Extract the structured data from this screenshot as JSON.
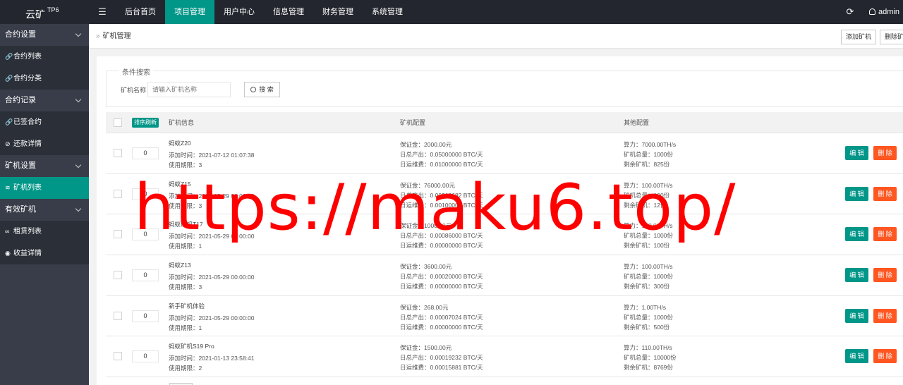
{
  "header": {
    "logo": "云矿",
    "logo_sup": "TP6",
    "menu_toggle": "☰",
    "nav": [
      "后台首页",
      "项目管理",
      "用户中心",
      "信息管理",
      "财务管理",
      "系统管理"
    ],
    "active_nav": 1,
    "refresh_icon": "⟳",
    "user": "admin"
  },
  "sidebar": {
    "groups": [
      {
        "label": "合约设置",
        "items": [
          {
            "icon": "🔗",
            "label": "合约列表"
          },
          {
            "icon": "🔗",
            "label": "合约分类"
          }
        ]
      },
      {
        "label": "合约记录",
        "items": [
          {
            "icon": "🔗",
            "label": "已签合约"
          },
          {
            "icon": "⊘",
            "label": "还款详情"
          }
        ]
      },
      {
        "label": "矿机设置",
        "items": [
          {
            "icon": "≋",
            "label": "矿机列表",
            "active": true
          }
        ]
      },
      {
        "label": "有效矿机",
        "items": [
          {
            "icon": "∞",
            "label": "租赁列表"
          },
          {
            "icon": "◉",
            "label": "收益详情"
          }
        ]
      }
    ]
  },
  "breadcrumb": {
    "sep": "»",
    "label": "矿机管理"
  },
  "toolbar": {
    "add": "添加矿机",
    "delete": "删除矿"
  },
  "search": {
    "legend": "条件搜索",
    "field_label": "矿机名称",
    "placeholder": "请输入矿机名称",
    "button": "搜 索"
  },
  "table": {
    "sort_button": "排序刷新",
    "headers": [
      "矿机信息",
      "矿机配置",
      "其他配置"
    ],
    "edit_label": "编 辑",
    "delete_label": "删 除",
    "rows": [
      {
        "sort": "0",
        "name": "蚂蚁Z20",
        "added": "添加时间：2021-07-12 01:07:38",
        "period": "使用期限：3",
        "deposit": "保证金：2000.00元",
        "output": "日总产出：0.05000000 BTC/天",
        "fee": "日运维费：0.01000000 BTC/天",
        "power": "算力：7000.00TH/s",
        "total": "矿机总量：1000份",
        "remain": "剩余矿机：825份"
      },
      {
        "sort": "0",
        "name": "蚂蚁Z15",
        "added": "添加时间：2021-05-29 00:00:00",
        "period": "使用期限：3",
        "deposit": "保证金：76000.00元",
        "output": "日总产出：0.00216682 BTC/天",
        "fee": "日运维费：0.00100000 BTC/天",
        "power": "算力：100.00TH/s",
        "total": "矿机总量：100份",
        "remain": "剩余矿机：12份"
      },
      {
        "sort": "0",
        "name": "蚂蚁矿机T17",
        "added": "添加时间：2021-05-29 00:00:00",
        "period": "使用期限：1",
        "deposit": "保证金：1000.00元",
        "output": "日总产出：0.00086000 BTC/天",
        "fee": "日运维费：0.00000000 BTC/天",
        "power": "算力：100.00TH/s",
        "total": "矿机总量：1000份",
        "remain": "剩余矿机：100份"
      },
      {
        "sort": "0",
        "name": "蚂蚁Z13",
        "added": "添加时间：2021-05-29 00:00:00",
        "period": "使用期限：3",
        "deposit": "保证金：3600.00元",
        "output": "日总产出：0.00020000 BTC/天",
        "fee": "日运维费：0.00000000 BTC/天",
        "power": "算力：100.00TH/s",
        "total": "矿机总量：1000份",
        "remain": "剩余矿机：300份"
      },
      {
        "sort": "0",
        "name": "新手矿机体验",
        "added": "添加时间：2021-05-29 00:00:00",
        "period": "使用期限：1",
        "deposit": "保证金：268.00元",
        "output": "日总产出：0.00007024 BTC/天",
        "fee": "日运维费：0.00000000 BTC/天",
        "power": "算力：1.00TH/s",
        "total": "矿机总量：1000份",
        "remain": "剩余矿机：500份"
      },
      {
        "sort": "0",
        "name": "蚂蚁矿机S19 Pro",
        "added": "添加时间：2021-01-13 23:58:41",
        "period": "使用期限：2",
        "deposit": "保证金：1500.00元",
        "output": "日总产出：0.00019232 BTC/天",
        "fee": "日运维费：0.00015881 BTC/天",
        "power": "算力：110.00TH/s",
        "total": "矿机总量：10000份",
        "remain": "剩余矿机：8769份"
      }
    ]
  },
  "watermark": "https://maku6.top/",
  "colors": {
    "accent": "#009688",
    "danger": "#ff5722",
    "header": "#23262e",
    "sidebar": "#393d49",
    "watermark": "#ff0000"
  }
}
